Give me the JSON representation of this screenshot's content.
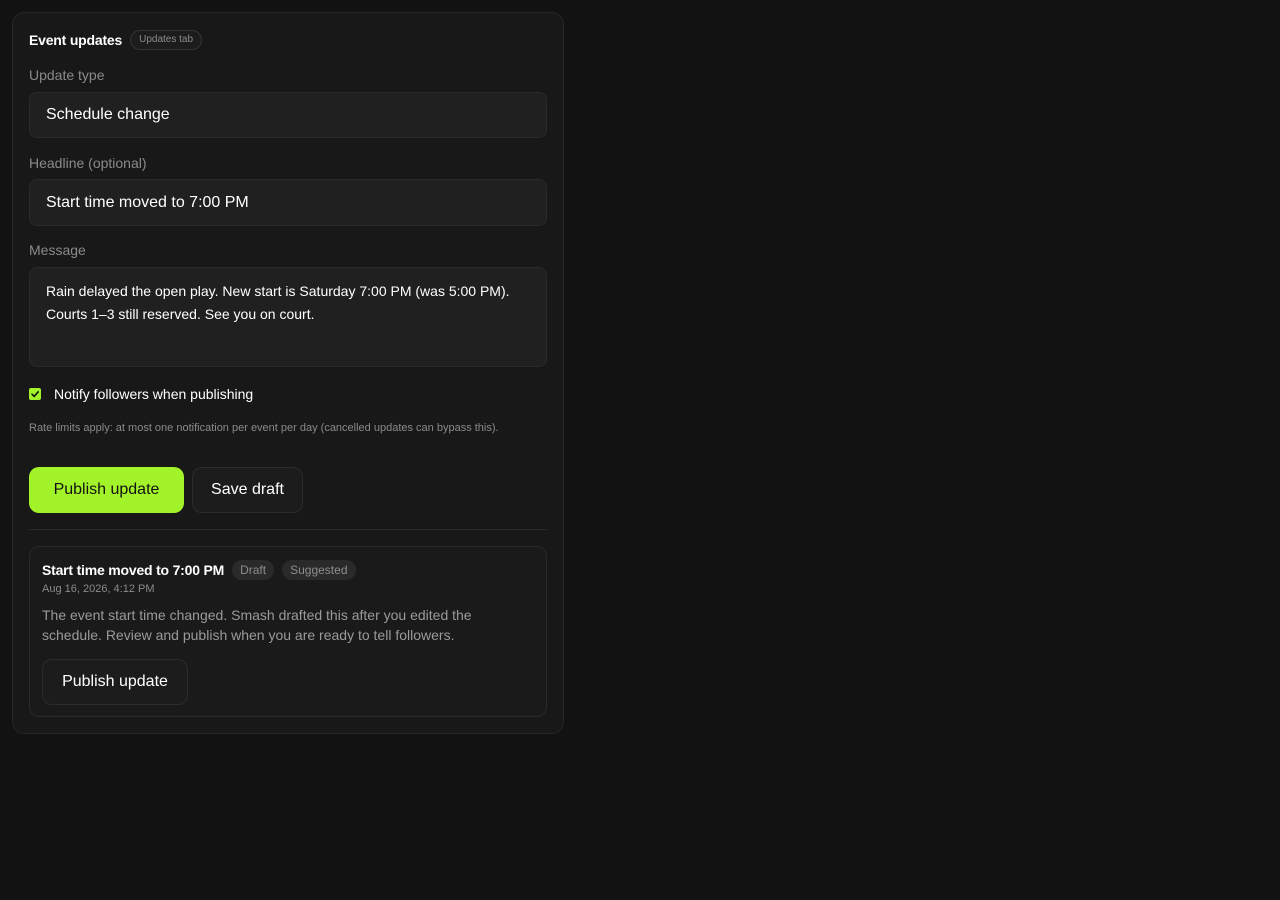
{
  "header": {
    "title": "Event updates",
    "tag": "Updates tab"
  },
  "form": {
    "update_type_label": "Update type",
    "update_type_value": "Schedule change",
    "headline_label": "Headline (optional)",
    "headline_value": "Start time moved to 7:00 PM",
    "message_label": "Message",
    "message_value": "Rain delayed the open play. New start is Saturday 7:00 PM (was 5:00 PM).\nCourts 1–3 still reserved. See you on court.",
    "notify_label": "Notify followers when publishing",
    "notify_checked": true,
    "rate_note": "Rate limits apply: at most one notification per event per day (cancelled updates can bypass this).",
    "publish_label": "Publish update",
    "save_draft_label": "Save draft"
  },
  "draft_card": {
    "title": "Start time moved to 7:00 PM",
    "badge_status": "Draft",
    "badge_source": "Suggested",
    "date": "Aug 16, 2026, 4:12 PM",
    "description": "The event start time changed. Smash drafted this after you edited the schedule. Review and publish when you are ready to tell followers.",
    "publish_label": "Publish update"
  },
  "colors": {
    "accent": "#a3f32a",
    "background": "#121212",
    "panel": "#181818"
  }
}
